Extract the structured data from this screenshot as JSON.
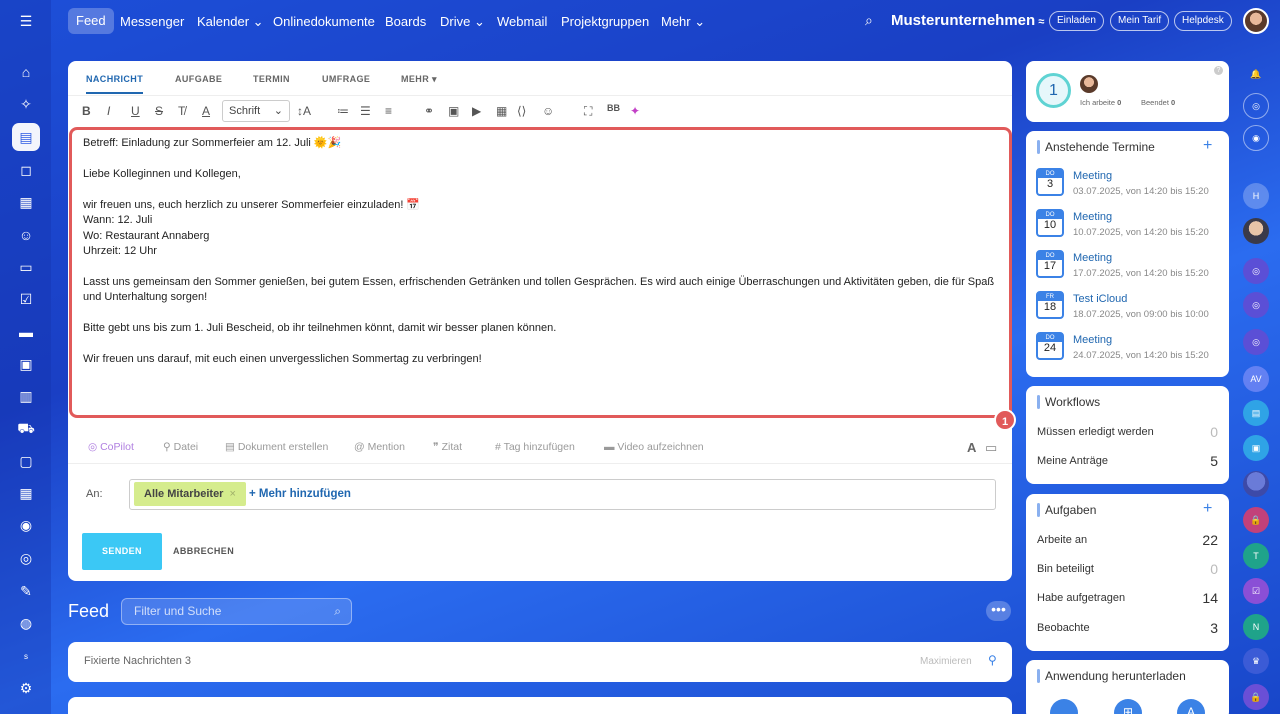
{
  "topnav": {
    "feed": "Feed",
    "items": [
      "Messenger",
      "Kalender",
      "Onlinedokumente",
      "Boards",
      "Drive",
      "Webmail",
      "Projektgruppen",
      "Mehr"
    ],
    "company": "Musterunternehmen",
    "buttons": [
      "Einladen",
      "Mein Tarif",
      "Helpdesk"
    ]
  },
  "composer": {
    "tabs": [
      "NACHRICHT",
      "AUFGABE",
      "TERMIN",
      "UMFRAGE",
      "MEHR"
    ],
    "font_select": "Schrift",
    "lines": [
      "Betreff: Einladung zur Sommerfeier am 12. Juli 🌞🎉",
      "Liebe Kolleginnen und Kollegen,",
      "wir freuen uns, euch herzlich zu unserer Sommerfeier einzuladen! 📅",
      "Wann: 12. Juli",
      "Wo: Restaurant Annaberg",
      "Uhrzeit: 12 Uhr",
      "Lasst uns gemeinsam den Sommer genießen, bei gutem Essen, erfrischenden Getränken und tollen Gesprächen. Es wird auch einige Überraschungen und Aktivitäten geben, die für Spaß",
      "und Unterhaltung sorgen!",
      "Bitte gebt uns bis zum 1. Juli Bescheid, ob ihr teilnehmen könnt, damit wir besser planen können.",
      "Wir freuen uns darauf, mit euch einen unvergesslichen Sommertag zu verbringen!"
    ],
    "callout": "1",
    "actions": [
      "CoPilot",
      "Datei",
      "Dokument erstellen",
      "Mention",
      "Zitat",
      "Tag hinzufügen",
      "Video aufzeichnen"
    ],
    "to_label": "An:",
    "recipient": "Alle Mitarbeiter",
    "add_more": "+ Mehr hinzufügen",
    "send": "SENDEN",
    "cancel": "ABBRECHEN"
  },
  "feed": {
    "title": "Feed",
    "filter_placeholder": "Filter und Suche",
    "pinned": "Fixierte Nachrichten",
    "pinned_count": "3",
    "maximize": "Maximieren"
  },
  "status": {
    "count": "1",
    "working_label": "Ich arbeite",
    "working_value": "0",
    "done_label": "Beendet",
    "done_value": "0"
  },
  "events": {
    "title": "Anstehende Termine",
    "items": [
      {
        "dow": "DO",
        "day": "3",
        "name": "Meeting",
        "time": "03.07.2025, von 14:20 bis 15:20"
      },
      {
        "dow": "DO",
        "day": "10",
        "name": "Meeting",
        "time": "10.07.2025, von 14:20 bis 15:20"
      },
      {
        "dow": "DO",
        "day": "17",
        "name": "Meeting",
        "time": "17.07.2025, von 14:20 bis 15:20"
      },
      {
        "dow": "FR",
        "day": "18",
        "name": "Test iCloud",
        "time": "18.07.2025, von 09:00 bis 10:00"
      },
      {
        "dow": "DO",
        "day": "24",
        "name": "Meeting",
        "time": "24.07.2025, von 14:20 bis 15:20"
      }
    ]
  },
  "workflows": {
    "title": "Workflows",
    "rows": [
      {
        "label": "Müssen erledigt werden",
        "value": "0"
      },
      {
        "label": "Meine Anträge",
        "value": "5"
      }
    ]
  },
  "tasks": {
    "title": "Aufgaben",
    "rows": [
      {
        "label": "Arbeite an",
        "value": "22"
      },
      {
        "label": "Bin beteiligt",
        "value": "0"
      },
      {
        "label": "Habe aufgetragen",
        "value": "14"
      },
      {
        "label": "Beobachte",
        "value": "3"
      }
    ]
  },
  "download": {
    "title": "Anwendung herunterladen"
  }
}
